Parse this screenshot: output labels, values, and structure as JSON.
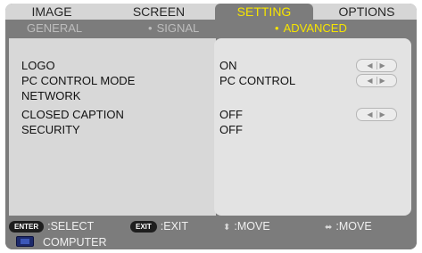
{
  "tabs": [
    {
      "label": "IMAGE",
      "active": false
    },
    {
      "label": "SCREEN",
      "active": false
    },
    {
      "label": "SETTING",
      "active": true
    },
    {
      "label": "OPTIONS",
      "active": false
    }
  ],
  "subtabs": [
    {
      "label": "GENERAL",
      "active": false
    },
    {
      "label": "SIGNAL",
      "active": false
    },
    {
      "label": "ADVANCED",
      "active": true
    }
  ],
  "rows": [
    {
      "label": "LOGO",
      "value": "ON",
      "has_arrows": true
    },
    {
      "label": "PC CONTROL MODE",
      "value": "PC CONTROL",
      "has_arrows": true
    },
    {
      "label": "NETWORK",
      "value": "",
      "has_arrows": false
    },
    {
      "label": "CLOSED CAPTION",
      "value": "OFF",
      "has_arrows": true
    },
    {
      "label": "SECURITY",
      "value": "OFF",
      "has_arrows": false
    }
  ],
  "footer": {
    "enter_key": "ENTER",
    "select_label": ":SELECT",
    "exit_key": "EXIT",
    "exit_label": ":EXIT",
    "updown_icon": "up-down-arrows-icon",
    "move_label_1": ":MOVE",
    "leftright_icon": "left-right-arrows-icon",
    "move_label_2": ":MOVE",
    "source_icon": "monitor-icon",
    "source_label": "COMPUTER"
  },
  "colors": {
    "active_tab_text": "#f6e400",
    "menu_background": "#7c7c7c",
    "panel_background": "#d8d8d8"
  }
}
